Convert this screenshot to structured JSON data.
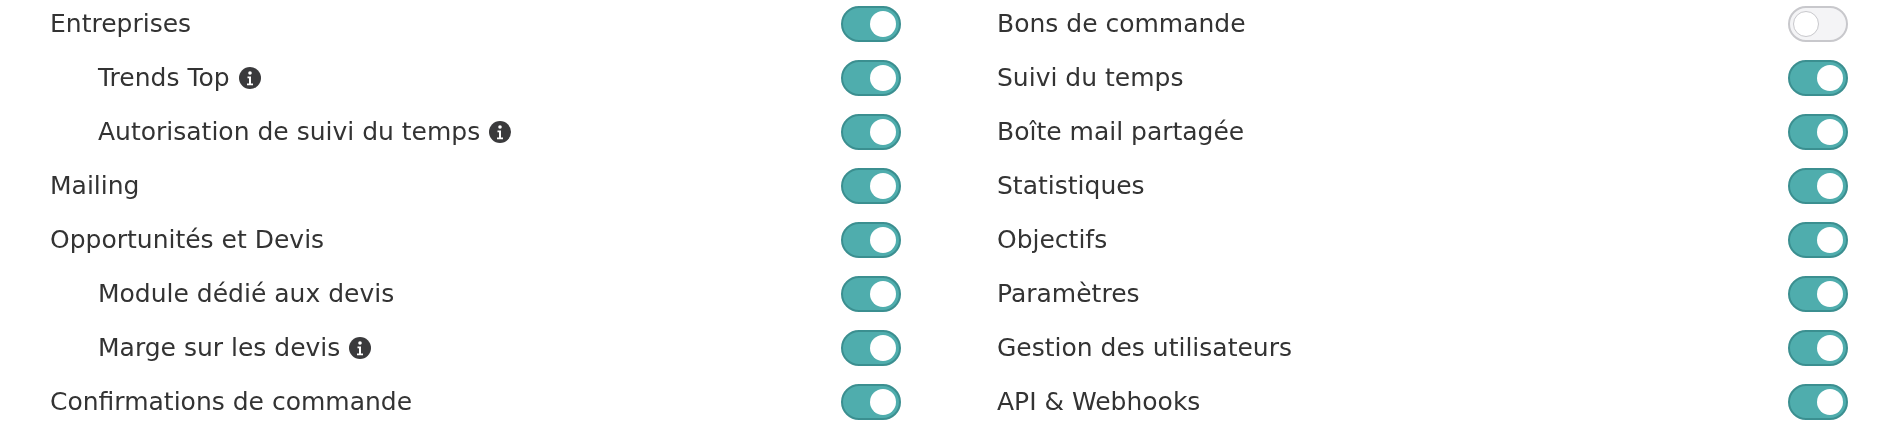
{
  "columns": [
    {
      "items": [
        {
          "label": "Entreprises",
          "info": false,
          "on": true,
          "children": [
            {
              "label": "Trends Top",
              "info": true,
              "on": true
            },
            {
              "label": "Autorisation de suivi du temps",
              "info": true,
              "on": true
            }
          ]
        },
        {
          "label": "Mailing",
          "info": false,
          "on": true
        },
        {
          "label": "Opportunités et Devis",
          "info": false,
          "on": true,
          "children": [
            {
              "label": "Module dédié aux devis",
              "info": false,
              "on": true
            },
            {
              "label": "Marge sur les devis",
              "info": true,
              "on": true
            }
          ]
        },
        {
          "label": "Confirmations de commande",
          "info": false,
          "on": true
        }
      ]
    },
    {
      "items": [
        {
          "label": "Bons de commande",
          "info": false,
          "on": false
        },
        {
          "label": "Suivi du temps",
          "info": false,
          "on": true
        },
        {
          "label": "Boîte mail partagée",
          "info": false,
          "on": true
        },
        {
          "label": "Statistiques",
          "info": false,
          "on": true
        },
        {
          "label": "Objectifs",
          "info": false,
          "on": true
        },
        {
          "label": "Paramètres",
          "info": false,
          "on": true
        },
        {
          "label": "Gestion des utilisateurs",
          "info": false,
          "on": true
        },
        {
          "label": "API & Webhooks",
          "info": false,
          "on": true
        }
      ]
    }
  ]
}
